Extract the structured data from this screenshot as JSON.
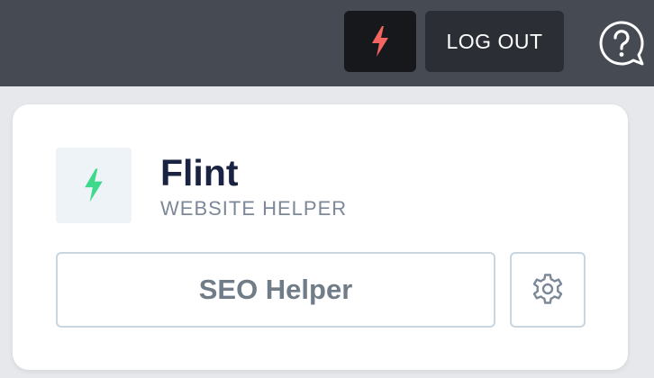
{
  "topbar": {
    "flash_icon": "lightning-bolt-icon",
    "flash_color": "#f46561",
    "logout_label": "LOG OUT",
    "help_icon": "question-bubble-icon"
  },
  "card": {
    "app_icon": "lightning-bolt-icon",
    "app_icon_color": "#3fd98c",
    "app_name": "Flint",
    "app_subtitle": "WEBSITE HELPER",
    "primary_button_label": "SEO Helper",
    "settings_icon": "gear-icon"
  },
  "colors": {
    "topbar_bg": "#464a53",
    "title_color": "#1a2341",
    "muted_text": "#7c8897",
    "button_border": "#c9d6e0"
  }
}
